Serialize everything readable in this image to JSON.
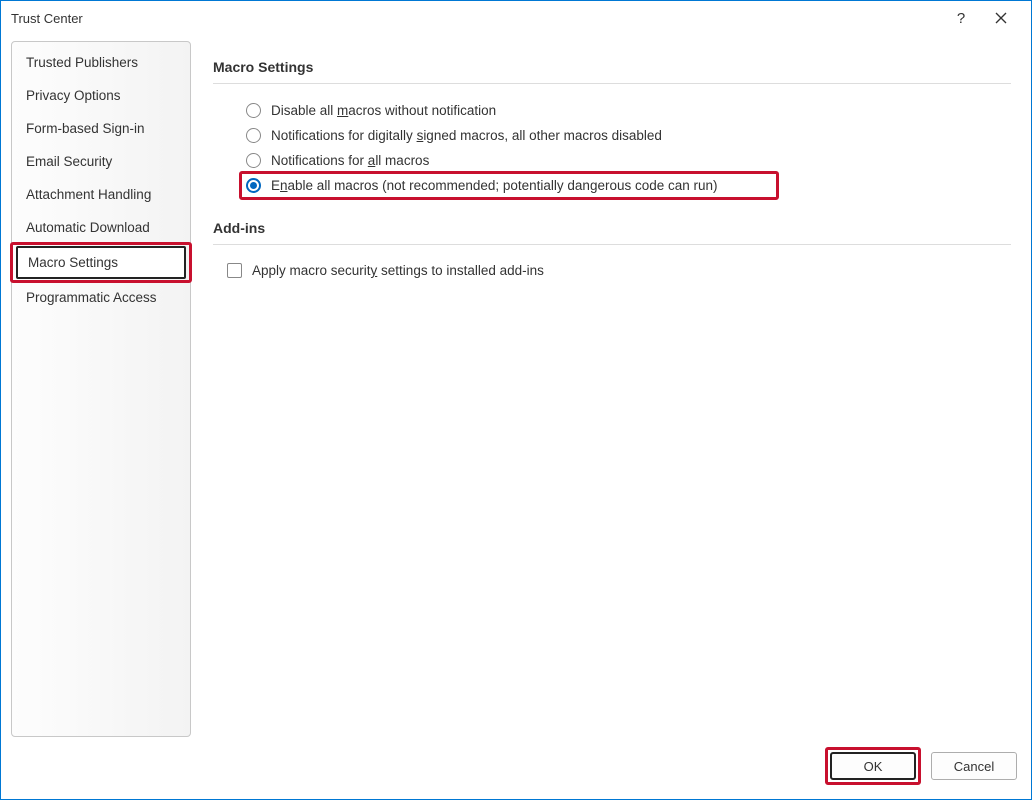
{
  "window": {
    "title": "Trust Center"
  },
  "sidebar": {
    "items": [
      {
        "label": "Trusted Publishers",
        "selected": false
      },
      {
        "label": "Privacy Options",
        "selected": false
      },
      {
        "label": "Form-based Sign-in",
        "selected": false
      },
      {
        "label": "Email Security",
        "selected": false
      },
      {
        "label": "Attachment Handling",
        "selected": false
      },
      {
        "label": "Automatic Download",
        "selected": false
      },
      {
        "label": "Macro Settings",
        "selected": true
      },
      {
        "label": "Programmatic Access",
        "selected": false
      }
    ]
  },
  "sections": {
    "macro": {
      "heading": "Macro Settings",
      "options": [
        {
          "pre": "Disable all ",
          "u": "m",
          "post": "acros without notification",
          "checked": false
        },
        {
          "pre": "Notifications for digitally ",
          "u": "s",
          "post": "igned macros, all other macros disabled",
          "checked": false
        },
        {
          "pre": "Notifications for ",
          "u": "a",
          "post": "ll macros",
          "checked": false
        },
        {
          "pre": "E",
          "u": "n",
          "post": "able all macros (not recommended; potentially dangerous code can run)",
          "checked": true
        }
      ]
    },
    "addins": {
      "heading": "Add-ins",
      "checkbox": {
        "pre": "Apply macro securit",
        "u": "y",
        "post": " settings to installed add-ins",
        "checked": false
      }
    }
  },
  "footer": {
    "ok": "OK",
    "cancel": "Cancel"
  }
}
